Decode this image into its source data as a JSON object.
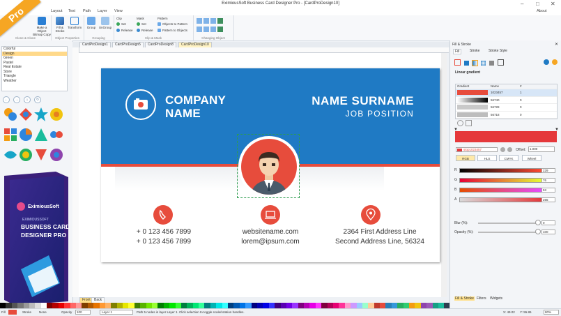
{
  "app": {
    "title": "EximiousSoft Business Card Designer Pro - [CardProDesign10]",
    "corner_badge": "Pro",
    "about": "About"
  },
  "menu": {
    "tabs": [
      "Layout",
      "Text",
      "Path",
      "Layer",
      "View"
    ]
  },
  "ribbon": {
    "groups": {
      "clone": "Clone & Clone",
      "object_properties": "Object Properties",
      "grouping": "Grouping",
      "clip_mask": "Clip & Mask",
      "changing_object": "Changing Object"
    },
    "buttons": {
      "make_object": "Make a Object",
      "bitmap_copy": "Bitmap Copy",
      "fill_stroke": "Fill & Stroke",
      "transform": "Transform",
      "group": "Group",
      "ungroup": "UnGroup",
      "clip": "Clip",
      "clip_set": "Set",
      "clip_release": "Release",
      "mask": "Mask",
      "mask_set": "Set",
      "mask_release": "Release",
      "pattern": "Pattern",
      "objects_to_pattern": "Objects to Pattern",
      "pattern_to_objects": "Pattern to Objects"
    }
  },
  "left_panel": {
    "styles": [
      "Colorful",
      "Design",
      "Green",
      "Pastel",
      "Real Estate",
      "Store",
      "Triangle",
      "Weather"
    ],
    "selected_style": "Design"
  },
  "doc_tabs": [
    "CardProDesign1",
    "CardProDesign5",
    "CardProDesign8",
    "CardProDesign10"
  ],
  "active_doc": "CardProDesign10",
  "card": {
    "company_line1": "COMPANY",
    "company_line2": "NAME",
    "name": "NAME SURNAME",
    "job": "JOB POSITION",
    "phone1": "+ 0 123 456 7899",
    "phone2": "+ 0 123 456 7899",
    "website": "websitename.com",
    "email": "lorem@ipsum.com",
    "address1": "2364 First Address Line",
    "address2": "Second Address Line, 56324",
    "colors": {
      "band": "#1f7ac4",
      "accent": "#e74c3c"
    }
  },
  "product_box": {
    "brand": "EximiousSoft",
    "brand_small": "EXIMIOUSSOFT",
    "title1": "BUSINESS CARD",
    "title2": "DESIGNER PRO"
  },
  "bottom_tabs": [
    "Front",
    "Back"
  ],
  "right_panel": {
    "title": "Fill & Stroke",
    "tabs": [
      "Fill",
      "Stroke",
      "Stroke Style"
    ],
    "gradient_type": "Linear gradient",
    "table_headers": [
      "Gradient",
      "Name",
      "#"
    ],
    "gradients": [
      {
        "name": "1023457",
        "count": "1"
      },
      {
        "name": "56740",
        "count": "0"
      },
      {
        "name": "56728",
        "count": "0"
      },
      {
        "name": "56718",
        "count": "0"
      },
      {
        "name": "56706",
        "count": "0"
      }
    ],
    "stop_name": "stop1023457",
    "offset_label": "Offset:",
    "offset_value": "1.000",
    "modes": [
      "RGB",
      "HLS",
      "CMYK",
      "Wheel"
    ],
    "channels": [
      {
        "label": "R",
        "value": "229"
      },
      {
        "label": "G",
        "value": "76"
      },
      {
        "label": "B",
        "value": "53"
      },
      {
        "label": "A",
        "value": "255"
      }
    ],
    "blur_label": "Blur (%):",
    "blur_value": "0",
    "opacity_label": "Opacity (%):",
    "opacity_value": "100",
    "bottom_tabs": [
      "Fill & Stroke",
      "Filters",
      "Widgets"
    ]
  },
  "status": {
    "fill_label": "Fill",
    "stroke_label": "Stroke",
    "stroke_value": "None",
    "opacity_label": "Opacity",
    "opacity_value": "100",
    "layer": "Layer 1",
    "message": "Path 5 nodes in layer Layer 1. Click selection to toggle scale/rotation handles.",
    "x": "X: 49.02",
    "y": "Y: 55.86",
    "zoom": "80%"
  }
}
